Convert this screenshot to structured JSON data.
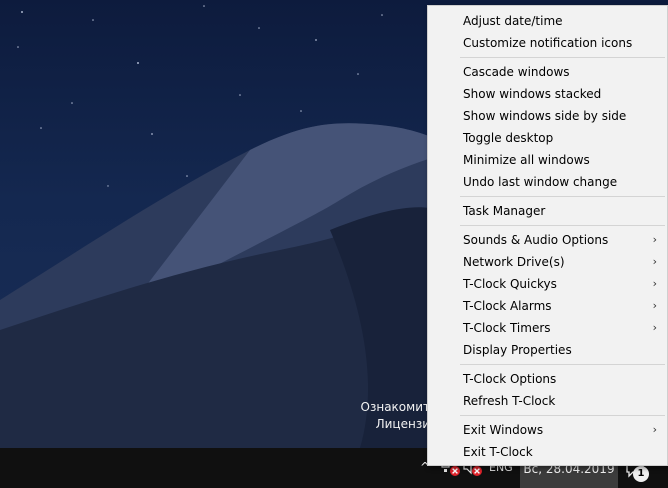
{
  "watermark": {
    "line1": "Ознакомит",
    "line2": "Лицензи"
  },
  "taskbar": {
    "chevron": "^",
    "language": "ENG",
    "clock": "Вс, 28.04.2019",
    "notification_count": "1"
  },
  "menu": {
    "items": [
      {
        "label": "Adjust date/time",
        "submenu": false
      },
      {
        "label": "Customize notification icons",
        "submenu": false
      },
      {
        "label": "Cascade windows",
        "submenu": false
      },
      {
        "label": "Show windows stacked",
        "submenu": false
      },
      {
        "label": "Show windows side by side",
        "submenu": false
      },
      {
        "label": "Toggle desktop",
        "submenu": false
      },
      {
        "label": "Minimize all windows",
        "submenu": false
      },
      {
        "label": "Undo last window change",
        "submenu": false
      },
      {
        "label": "Task Manager",
        "submenu": false
      },
      {
        "label": "Sounds & Audio Options",
        "submenu": true
      },
      {
        "label": "Network Drive(s)",
        "submenu": true
      },
      {
        "label": "T-Clock Quickys",
        "submenu": true
      },
      {
        "label": "T-Clock Alarms",
        "submenu": true
      },
      {
        "label": "T-Clock Timers",
        "submenu": true
      },
      {
        "label": "Display Properties",
        "submenu": false
      },
      {
        "label": "T-Clock Options",
        "submenu": false
      },
      {
        "label": "Refresh T-Clock",
        "submenu": false
      },
      {
        "label": "Exit Windows",
        "submenu": true
      },
      {
        "label": "Exit T-Clock",
        "submenu": false
      }
    ],
    "submenu_arrow": "›"
  },
  "colors": {
    "menu_bg": "#f2f2f2",
    "taskbar_bg": "#101010",
    "clock_bg": "#3c3c3c",
    "status_red": "#e0232b"
  }
}
